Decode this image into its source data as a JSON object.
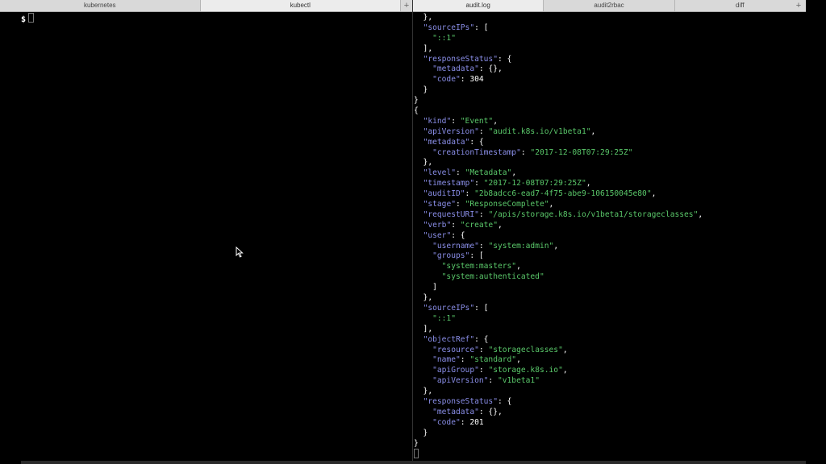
{
  "tabs_left": [
    {
      "label": "kubernetes",
      "active": false
    },
    {
      "label": "kubectl",
      "active": true
    }
  ],
  "tabs_right": [
    {
      "label": "audit.log",
      "active": true
    },
    {
      "label": "audit2rbac",
      "active": false
    },
    {
      "label": "diff",
      "active": false
    }
  ],
  "plus_label": "+",
  "prompt": "$",
  "colors": {
    "key": "#8a8ee8",
    "string": "#5ac86a",
    "background": "#000000"
  },
  "log_lines": [
    [
      {
        "t": "  },",
        "c": "p"
      }
    ],
    [
      {
        "t": "  ",
        "c": "p"
      },
      {
        "t": "\"sourceIPs\"",
        "c": "k"
      },
      {
        "t": ": [",
        "c": "p"
      }
    ],
    [
      {
        "t": "    ",
        "c": "p"
      },
      {
        "t": "\"::1\"",
        "c": "s"
      }
    ],
    [
      {
        "t": "  ],",
        "c": "p"
      }
    ],
    [
      {
        "t": "  ",
        "c": "p"
      },
      {
        "t": "\"responseStatus\"",
        "c": "k"
      },
      {
        "t": ": {",
        "c": "p"
      }
    ],
    [
      {
        "t": "    ",
        "c": "p"
      },
      {
        "t": "\"metadata\"",
        "c": "k"
      },
      {
        "t": ": {},",
        "c": "p"
      }
    ],
    [
      {
        "t": "    ",
        "c": "p"
      },
      {
        "t": "\"code\"",
        "c": "k"
      },
      {
        "t": ": ",
        "c": "p"
      },
      {
        "t": "304",
        "c": "n"
      }
    ],
    [
      {
        "t": "  }",
        "c": "p"
      }
    ],
    [
      {
        "t": "}",
        "c": "p"
      }
    ],
    [
      {
        "t": "{",
        "c": "p"
      }
    ],
    [
      {
        "t": "  ",
        "c": "p"
      },
      {
        "t": "\"kind\"",
        "c": "k"
      },
      {
        "t": ": ",
        "c": "p"
      },
      {
        "t": "\"Event\"",
        "c": "s"
      },
      {
        "t": ",",
        "c": "p"
      }
    ],
    [
      {
        "t": "  ",
        "c": "p"
      },
      {
        "t": "\"apiVersion\"",
        "c": "k"
      },
      {
        "t": ": ",
        "c": "p"
      },
      {
        "t": "\"audit.k8s.io/v1beta1\"",
        "c": "s"
      },
      {
        "t": ",",
        "c": "p"
      }
    ],
    [
      {
        "t": "  ",
        "c": "p"
      },
      {
        "t": "\"metadata\"",
        "c": "k"
      },
      {
        "t": ": {",
        "c": "p"
      }
    ],
    [
      {
        "t": "    ",
        "c": "p"
      },
      {
        "t": "\"creationTimestamp\"",
        "c": "k"
      },
      {
        "t": ": ",
        "c": "p"
      },
      {
        "t": "\"2017-12-08T07:29:25Z\"",
        "c": "s"
      }
    ],
    [
      {
        "t": "  },",
        "c": "p"
      }
    ],
    [
      {
        "t": "  ",
        "c": "p"
      },
      {
        "t": "\"level\"",
        "c": "k"
      },
      {
        "t": ": ",
        "c": "p"
      },
      {
        "t": "\"Metadata\"",
        "c": "s"
      },
      {
        "t": ",",
        "c": "p"
      }
    ],
    [
      {
        "t": "  ",
        "c": "p"
      },
      {
        "t": "\"timestamp\"",
        "c": "k"
      },
      {
        "t": ": ",
        "c": "p"
      },
      {
        "t": "\"2017-12-08T07:29:25Z\"",
        "c": "s"
      },
      {
        "t": ",",
        "c": "p"
      }
    ],
    [
      {
        "t": "  ",
        "c": "p"
      },
      {
        "t": "\"auditID\"",
        "c": "k"
      },
      {
        "t": ": ",
        "c": "p"
      },
      {
        "t": "\"2b8adcc6-ead7-4f75-abe9-106150045e80\"",
        "c": "s"
      },
      {
        "t": ",",
        "c": "p"
      }
    ],
    [
      {
        "t": "  ",
        "c": "p"
      },
      {
        "t": "\"stage\"",
        "c": "k"
      },
      {
        "t": ": ",
        "c": "p"
      },
      {
        "t": "\"ResponseComplete\"",
        "c": "s"
      },
      {
        "t": ",",
        "c": "p"
      }
    ],
    [
      {
        "t": "  ",
        "c": "p"
      },
      {
        "t": "\"requestURI\"",
        "c": "k"
      },
      {
        "t": ": ",
        "c": "p"
      },
      {
        "t": "\"/apis/storage.k8s.io/v1beta1/storageclasses\"",
        "c": "s"
      },
      {
        "t": ",",
        "c": "p"
      }
    ],
    [
      {
        "t": "  ",
        "c": "p"
      },
      {
        "t": "\"verb\"",
        "c": "k"
      },
      {
        "t": ": ",
        "c": "p"
      },
      {
        "t": "\"create\"",
        "c": "s"
      },
      {
        "t": ",",
        "c": "p"
      }
    ],
    [
      {
        "t": "  ",
        "c": "p"
      },
      {
        "t": "\"user\"",
        "c": "k"
      },
      {
        "t": ": {",
        "c": "p"
      }
    ],
    [
      {
        "t": "    ",
        "c": "p"
      },
      {
        "t": "\"username\"",
        "c": "k"
      },
      {
        "t": ": ",
        "c": "p"
      },
      {
        "t": "\"system:admin\"",
        "c": "s"
      },
      {
        "t": ",",
        "c": "p"
      }
    ],
    [
      {
        "t": "    ",
        "c": "p"
      },
      {
        "t": "\"groups\"",
        "c": "k"
      },
      {
        "t": ": [",
        "c": "p"
      }
    ],
    [
      {
        "t": "      ",
        "c": "p"
      },
      {
        "t": "\"system:masters\"",
        "c": "s"
      },
      {
        "t": ",",
        "c": "p"
      }
    ],
    [
      {
        "t": "      ",
        "c": "p"
      },
      {
        "t": "\"system:authenticated\"",
        "c": "s"
      }
    ],
    [
      {
        "t": "    ]",
        "c": "p"
      }
    ],
    [
      {
        "t": "  },",
        "c": "p"
      }
    ],
    [
      {
        "t": "  ",
        "c": "p"
      },
      {
        "t": "\"sourceIPs\"",
        "c": "k"
      },
      {
        "t": ": [",
        "c": "p"
      }
    ],
    [
      {
        "t": "    ",
        "c": "p"
      },
      {
        "t": "\"::1\"",
        "c": "s"
      }
    ],
    [
      {
        "t": "  ],",
        "c": "p"
      }
    ],
    [
      {
        "t": "  ",
        "c": "p"
      },
      {
        "t": "\"objectRef\"",
        "c": "k"
      },
      {
        "t": ": {",
        "c": "p"
      }
    ],
    [
      {
        "t": "    ",
        "c": "p"
      },
      {
        "t": "\"resource\"",
        "c": "k"
      },
      {
        "t": ": ",
        "c": "p"
      },
      {
        "t": "\"storageclasses\"",
        "c": "s"
      },
      {
        "t": ",",
        "c": "p"
      }
    ],
    [
      {
        "t": "    ",
        "c": "p"
      },
      {
        "t": "\"name\"",
        "c": "k"
      },
      {
        "t": ": ",
        "c": "p"
      },
      {
        "t": "\"standard\"",
        "c": "s"
      },
      {
        "t": ",",
        "c": "p"
      }
    ],
    [
      {
        "t": "    ",
        "c": "p"
      },
      {
        "t": "\"apiGroup\"",
        "c": "k"
      },
      {
        "t": ": ",
        "c": "p"
      },
      {
        "t": "\"storage.k8s.io\"",
        "c": "s"
      },
      {
        "t": ",",
        "c": "p"
      }
    ],
    [
      {
        "t": "    ",
        "c": "p"
      },
      {
        "t": "\"apiVersion\"",
        "c": "k"
      },
      {
        "t": ": ",
        "c": "p"
      },
      {
        "t": "\"v1beta1\"",
        "c": "s"
      }
    ],
    [
      {
        "t": "  },",
        "c": "p"
      }
    ],
    [
      {
        "t": "  ",
        "c": "p"
      },
      {
        "t": "\"responseStatus\"",
        "c": "k"
      },
      {
        "t": ": {",
        "c": "p"
      }
    ],
    [
      {
        "t": "    ",
        "c": "p"
      },
      {
        "t": "\"metadata\"",
        "c": "k"
      },
      {
        "t": ": {},",
        "c": "p"
      }
    ],
    [
      {
        "t": "    ",
        "c": "p"
      },
      {
        "t": "\"code\"",
        "c": "k"
      },
      {
        "t": ": ",
        "c": "p"
      },
      {
        "t": "201",
        "c": "n"
      }
    ],
    [
      {
        "t": "  }",
        "c": "p"
      }
    ],
    [
      {
        "t": "}",
        "c": "p"
      }
    ]
  ]
}
